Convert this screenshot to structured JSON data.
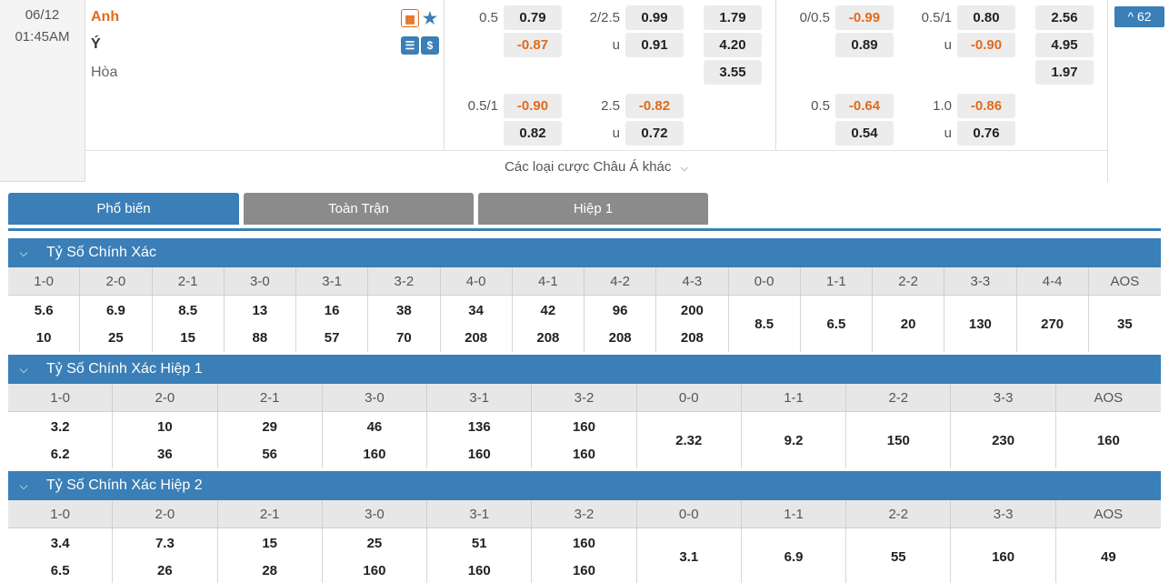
{
  "match": {
    "date": "06/12",
    "time": "01:45AM",
    "home": "Anh",
    "away": "Ý",
    "draw": "Hòa",
    "more_markets_count": "^ 62",
    "more_bets_label": "Các loại cược Châu Á khác"
  },
  "fulltime": {
    "hdp_row1": {
      "line": "0.5",
      "home": "0.79",
      "away": "-0.87"
    },
    "ou_row1": {
      "line": "2/2.5",
      "over": "0.99",
      "u_label": "u",
      "under": "0.91"
    },
    "x12": {
      "home": "1.79",
      "away": "4.20",
      "draw": "3.55"
    },
    "hdp_row2": {
      "line": "0.5/1",
      "home": "-0.90",
      "away": "0.82"
    },
    "ou_row2": {
      "line": "2.5",
      "over": "-0.82",
      "u_label": "u",
      "under": "0.72"
    }
  },
  "half1": {
    "hdp_row1": {
      "line": "0/0.5",
      "home": "-0.99",
      "away": "0.89"
    },
    "ou_row1": {
      "line": "0.5/1",
      "over": "0.80",
      "u_label": "u",
      "under": "-0.90"
    },
    "x12": {
      "home": "2.56",
      "away": "4.95",
      "draw": "1.97"
    },
    "hdp_row2": {
      "line": "0.5",
      "home": "-0.64",
      "away": "0.54"
    },
    "ou_row2": {
      "line": "1.0",
      "over": "-0.86",
      "u_label": "u",
      "under": "0.76"
    }
  },
  "tabs": [
    "Phổ biến",
    "Toàn Trận",
    "Hiệp 1"
  ],
  "sections": [
    {
      "title": "Tỷ Số Chính Xác",
      "headers": [
        "1-0",
        "2-0",
        "2-1",
        "3-0",
        "3-1",
        "3-2",
        "4-0",
        "4-1",
        "4-2",
        "4-3",
        "0-0",
        "1-1",
        "2-2",
        "3-3",
        "4-4",
        "AOS"
      ],
      "home": [
        "5.6",
        "6.9",
        "8.5",
        "13",
        "16",
        "38",
        "34",
        "42",
        "96",
        "200"
      ],
      "away": [
        "10",
        "25",
        "15",
        "88",
        "57",
        "70",
        "208",
        "208",
        "208",
        "208"
      ],
      "single": [
        "8.5",
        "6.5",
        "20",
        "130",
        "270",
        "35"
      ]
    },
    {
      "title": "Tỷ Số Chính Xác Hiệp 1",
      "headers": [
        "1-0",
        "2-0",
        "2-1",
        "3-0",
        "3-1",
        "3-2",
        "0-0",
        "1-1",
        "2-2",
        "3-3",
        "AOS"
      ],
      "home": [
        "3.2",
        "10",
        "29",
        "46",
        "136",
        "160"
      ],
      "away": [
        "6.2",
        "36",
        "56",
        "160",
        "160",
        "160"
      ],
      "single": [
        "2.32",
        "9.2",
        "150",
        "230",
        "160"
      ]
    },
    {
      "title": "Tỷ Số Chính Xác Hiệp 2",
      "headers": [
        "1-0",
        "2-0",
        "2-1",
        "3-0",
        "3-1",
        "3-2",
        "0-0",
        "1-1",
        "2-2",
        "3-3",
        "AOS"
      ],
      "home": [
        "3.4",
        "7.3",
        "15",
        "25",
        "51",
        "160"
      ],
      "away": [
        "6.5",
        "26",
        "28",
        "160",
        "160",
        "160"
      ],
      "single": [
        "3.1",
        "6.9",
        "55",
        "160",
        "49"
      ]
    }
  ],
  "colors": {
    "accent": "#3a7fb7",
    "negative": "#e26a1d",
    "home_team": "#e26a1d",
    "tab_inactive": "#8b8b8b"
  },
  "icons": {
    "home_icons": [
      "field-icon",
      "star-icon"
    ],
    "away_icons": [
      "scoreboard-icon",
      "dollar-icon"
    ],
    "chevron": "chevron-down-icon"
  }
}
